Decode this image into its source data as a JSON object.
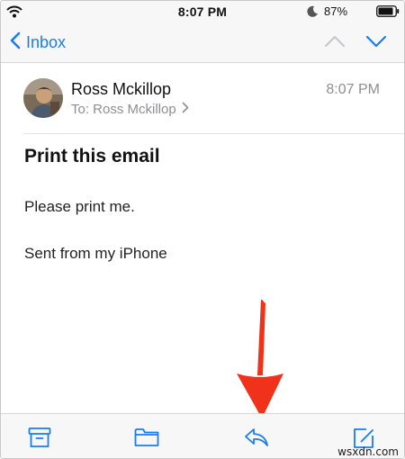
{
  "status_bar": {
    "time": "8:07 PM",
    "battery_percent": "87%",
    "icons": [
      "wifi-icon",
      "moon-icon",
      "battery-icon"
    ]
  },
  "nav": {
    "back_label": "Inbox",
    "icons": [
      "chevron-left-icon",
      "chevron-up-icon",
      "chevron-down-icon"
    ]
  },
  "email": {
    "sender": "Ross Mckillop",
    "to_line": "To: Ross Mckillop",
    "time": "8:07 PM",
    "subject": "Print this email",
    "body": [
      "Please print me.",
      "Sent from my iPhone"
    ]
  },
  "toolbar": {
    "icons": [
      "archive-icon",
      "folder-icon",
      "reply-icon",
      "compose-icon"
    ]
  },
  "watermark": "wsxdn.com",
  "colors": {
    "accent": "#1a7cf3",
    "secondary_text": "#8e8e93",
    "annotation_arrow": "#f0321a",
    "bar_background": "#f7f7f8"
  }
}
